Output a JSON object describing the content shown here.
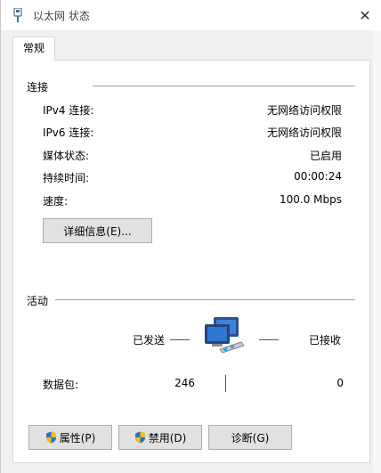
{
  "window": {
    "title": "以太网 状态",
    "close_glyph": "✕"
  },
  "tabs": [
    {
      "label": "常规",
      "active": true
    }
  ],
  "connection": {
    "group_label": "连接",
    "rows": [
      {
        "label": "IPv4 连接:",
        "value": "无网络访问权限"
      },
      {
        "label": "IPv6 连接:",
        "value": "无网络访问权限"
      },
      {
        "label": "媒体状态:",
        "value": "已启用"
      },
      {
        "label": "持续时间:",
        "value": "00:00:24"
      },
      {
        "label": "速度:",
        "value": "100.0 Mbps"
      }
    ],
    "details_button": "详细信息(E)..."
  },
  "activity": {
    "group_label": "活动",
    "sent_label": "已发送",
    "received_label": "已接收",
    "packets_label": "数据包:",
    "packets_sent": "246",
    "packets_received": "0",
    "icon": "network-computers-icon"
  },
  "buttons": {
    "properties": "属性(P)",
    "disable": "禁用(D)",
    "diagnose": "诊断(G)"
  },
  "colors": {
    "shield_blue": "#2a6fcf",
    "shield_yellow": "#f2c400"
  }
}
